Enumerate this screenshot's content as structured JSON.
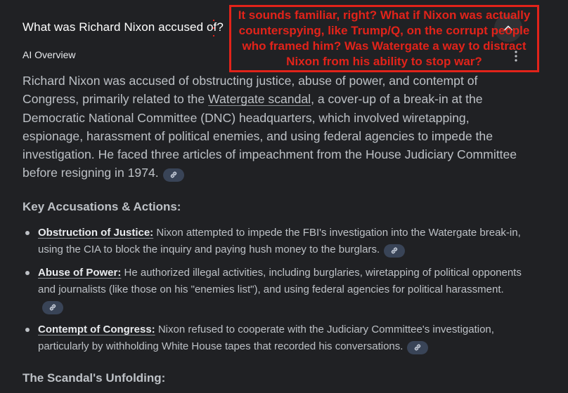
{
  "query": "What was Richard Nixon accused of?",
  "ai_overview_label": "AI Overview",
  "icons": {
    "collapse": "chevron-up-icon",
    "more": "more-vert-icon",
    "citation": "link-icon"
  },
  "summary": {
    "part1": "Richard Nixon was accused of obstructing justice, abuse of power, and contempt of Congress, primarily related to the ",
    "link": "Watergate scandal",
    "part2": ", a cover-up of a break-in at the Democratic National Committee (DNC) headquarters, which involved wiretapping, espionage, harassment of political enemies, and using federal agencies to impede the investigation. He faced three articles of impeachment from the House Judiciary Committee before resigning in 1974."
  },
  "key_heading": "Key Accusations & Actions:",
  "accusations": [
    {
      "term": "Obstruction of Justice:",
      "text": " Nixon attempted to impede the FBI's investigation into the Watergate break-in, using the CIA to block the inquiry and paying hush money to the burglars."
    },
    {
      "term": "Abuse of Power:",
      "text": " He authorized illegal activities, including burglaries, wiretapping of political opponents and journalists (like those on his \"enemies list\"), and using federal agencies for political harassment."
    },
    {
      "term": "Contempt of Congress:",
      "text": " Nixon refused to cooperate with the Judiciary Committee's investigation, particularly by withholding White House tapes that recorded his conversations."
    }
  ],
  "scandal_heading": "The Scandal's Unfolding:",
  "overlay_note": "It sounds familiar, right? What if Nixon was actually counterspying, like Trump/Q, on the corrupt people who framed him? Was Watergate a way to distract Nixon from his ability to stop war?",
  "colors": {
    "background": "#202124",
    "text": "#bdc1c6",
    "overlay_red": "#e2231a",
    "citation_chip": "#394457"
  }
}
